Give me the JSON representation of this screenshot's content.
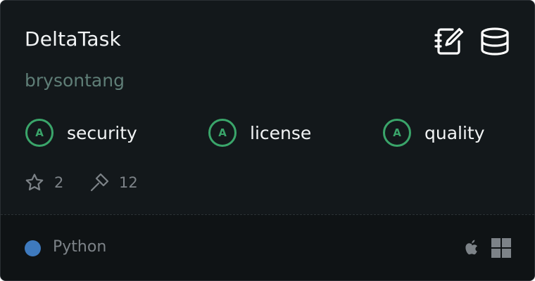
{
  "repo": {
    "name": "DeltaTask",
    "owner": "brysontang"
  },
  "actions": [
    {
      "icon": "notebook-edit-icon"
    },
    {
      "icon": "database-icon"
    }
  ],
  "grades": [
    {
      "grade": "A",
      "label": "security"
    },
    {
      "grade": "A",
      "label": "license"
    },
    {
      "grade": "A",
      "label": "quality"
    }
  ],
  "stats": {
    "stars": "2",
    "tools": "12"
  },
  "footer": {
    "language": "Python",
    "language_color": "#3e7abe",
    "platforms": [
      "apple-icon",
      "windows-icon"
    ]
  },
  "colors": {
    "background": "#13181b",
    "footer_background": "#0f1315",
    "grade_accent": "#3aa56a",
    "owner_text": "#5f7e77",
    "muted_text": "#7d8388"
  }
}
